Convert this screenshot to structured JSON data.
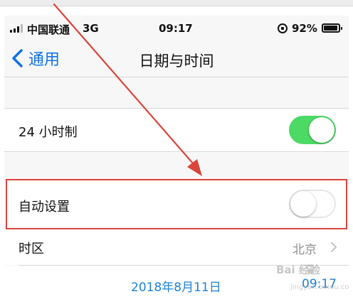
{
  "status_bar": {
    "carrier": "中国联通",
    "network": "3G",
    "time": "09:17",
    "battery_percent": "92%"
  },
  "nav": {
    "back_label": "通用",
    "title": "日期与时间"
  },
  "settings": {
    "hour24": {
      "label": "24 小时制",
      "state": "on"
    },
    "auto_set": {
      "label": "自动设置",
      "state": "off"
    },
    "timezone": {
      "label": "时区",
      "value": "北京"
    },
    "datetime": {
      "date": "2018年8月11日",
      "time": "09:17"
    }
  },
  "watermark": {
    "text": "Bai  经验",
    "sub": "jingyan.baidu.com"
  },
  "colors": {
    "accent_blue": "#1273e6",
    "toggle_on": "#4cd964",
    "highlight_red": "#d9453c",
    "arrow_red": "#d9453c"
  }
}
